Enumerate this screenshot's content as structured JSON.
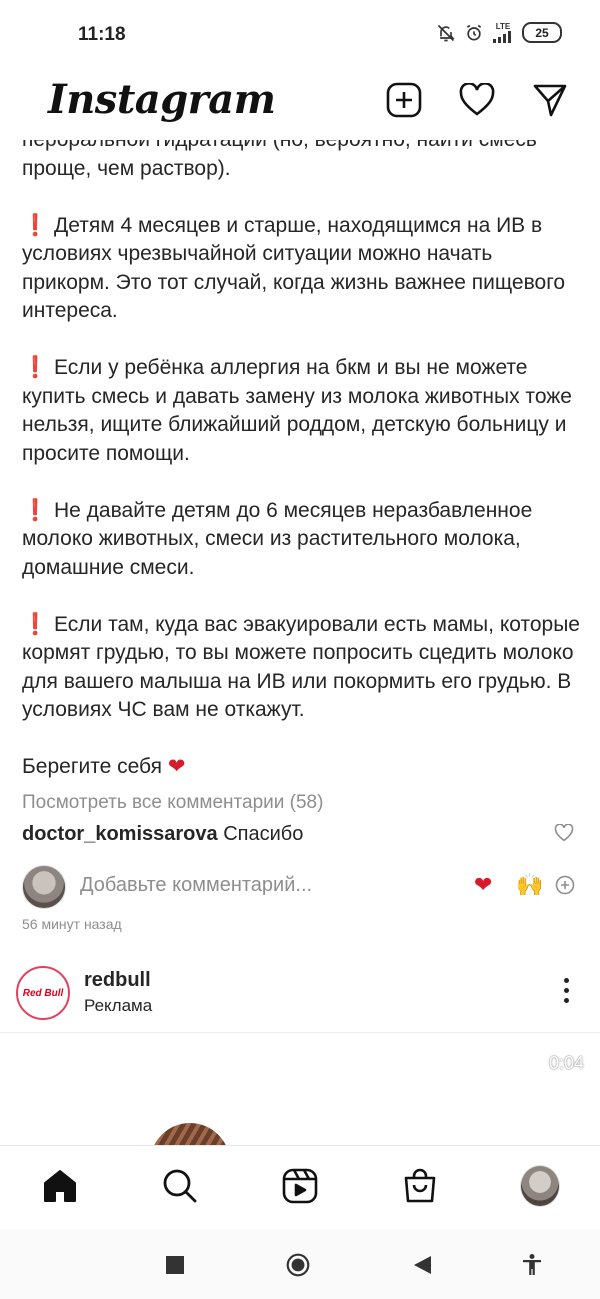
{
  "status_bar": {
    "time": "11:18",
    "network": "LTE",
    "battery": "25"
  },
  "app_bar": {
    "logo": "Instagram"
  },
  "caption": {
    "p0": "пероральной гидратации (но, вероятно, найти смесь проще, чем раствор).",
    "p1_mark": "❗",
    "p1": "Детям 4 месяцев и старше, находящимся на ИВ в условиях чрезвычайной ситуации можно начать прикорм. Это тот случай, когда жизнь важнее пищевого интереса.",
    "p2_mark": "❗",
    "p2": "Если у ребёнка аллергия на бкм и вы не можете купить смесь и давать замену из молока животных тоже нельзя, ищите ближайший роддом, детскую больницу и просите помощи.",
    "p3_mark": "❗",
    "p3": "Не давайте детям до 6 месяцев неразбавленное молоко животных, смеси из растительного молока, домашние смеси.",
    "p4_mark": "❗",
    "p4": "Если там, куда вас эвакуировали есть мамы, которые кормят грудью, то вы можете попросить сцедить молоко для вашего малыша на ИВ или покормить его грудью. В условиях ЧС вам не откажут.",
    "closing": "Берегите себя",
    "closing_heart": "❤"
  },
  "comments": {
    "view_all": "Посмотреть все комментарии (58)",
    "first_user": "doctor_komissarova",
    "first_text": "Спасибо"
  },
  "add_comment": {
    "placeholder": "Добавьте комментарий...",
    "quick_heart": "❤",
    "quick_hands": "🙌"
  },
  "post_time": "56 минут назад",
  "next_post": {
    "username": "redbull",
    "subtitle": "Реклама",
    "avatar_text": "Red Bull",
    "video_time": "0:04"
  },
  "colors": {
    "accent_red": "#d81b2b",
    "muted": "#8e8e8e"
  }
}
